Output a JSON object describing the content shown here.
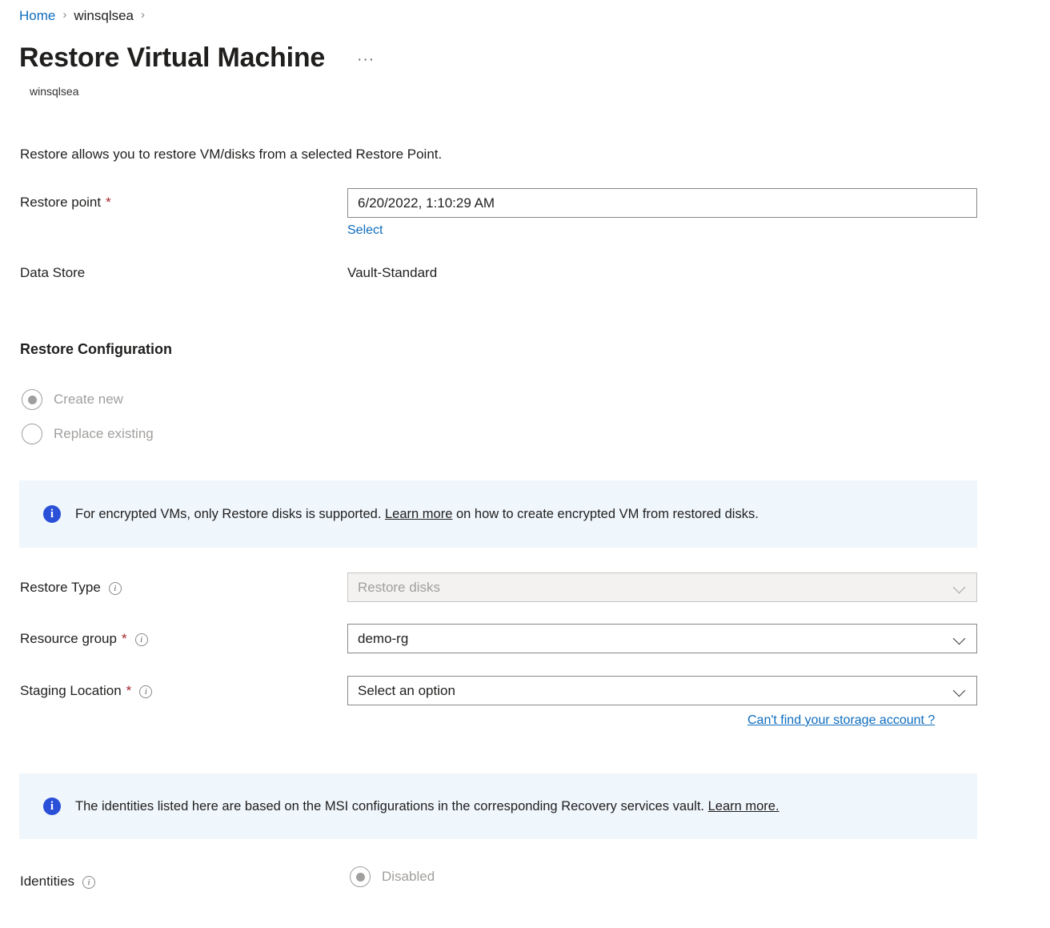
{
  "breadcrumb": {
    "home": "Home",
    "resource": "winsqlsea",
    "separator": "›"
  },
  "header": {
    "title": "Restore Virtual Machine",
    "subtitle": "winsqlsea",
    "more_menu": "···"
  },
  "intro": "Restore allows you to restore VM/disks from a selected Restore Point.",
  "restore_point": {
    "label": "Restore point",
    "required_mark": "*",
    "value": "6/20/2022, 1:10:29 AM",
    "select_link": "Select"
  },
  "data_store": {
    "label": "Data Store",
    "value": "Vault-Standard"
  },
  "restore_configuration": {
    "heading": "Restore Configuration",
    "options": [
      {
        "label": "Create new",
        "selected": true
      },
      {
        "label": "Replace existing",
        "selected": false
      }
    ]
  },
  "banner_encrypted": {
    "icon": "info-icon",
    "text_before": "For encrypted VMs, only Restore disks is supported. ",
    "link": "Learn more",
    "text_after": " on how to create encrypted VM from restored disks."
  },
  "restore_type": {
    "label": "Restore Type",
    "info": "ℹ",
    "value": "Restore disks",
    "disabled": true
  },
  "resource_group": {
    "label": "Resource group",
    "required_mark": "*",
    "value": "demo-rg"
  },
  "staging_location": {
    "label": "Staging Location",
    "required_mark": "*",
    "value": "Select an option",
    "help_link": "Can't find your storage account ?"
  },
  "banner_identities": {
    "icon": "info-icon",
    "text_before": "The identities listed here are based on the MSI configurations in the corresponding Recovery services vault. ",
    "link": "Learn more.",
    "text_after": ""
  },
  "identities": {
    "label": "Identities",
    "option_label": "Disabled",
    "selected": true
  },
  "colors": {
    "link": "#0f6cbd",
    "required": "#a4262c",
    "banner_bg": "#eff6fc",
    "banner_icon": "#2a50d8",
    "disabled_text": "#a19f9d",
    "disabled_field_bg": "#f3f2f1"
  }
}
